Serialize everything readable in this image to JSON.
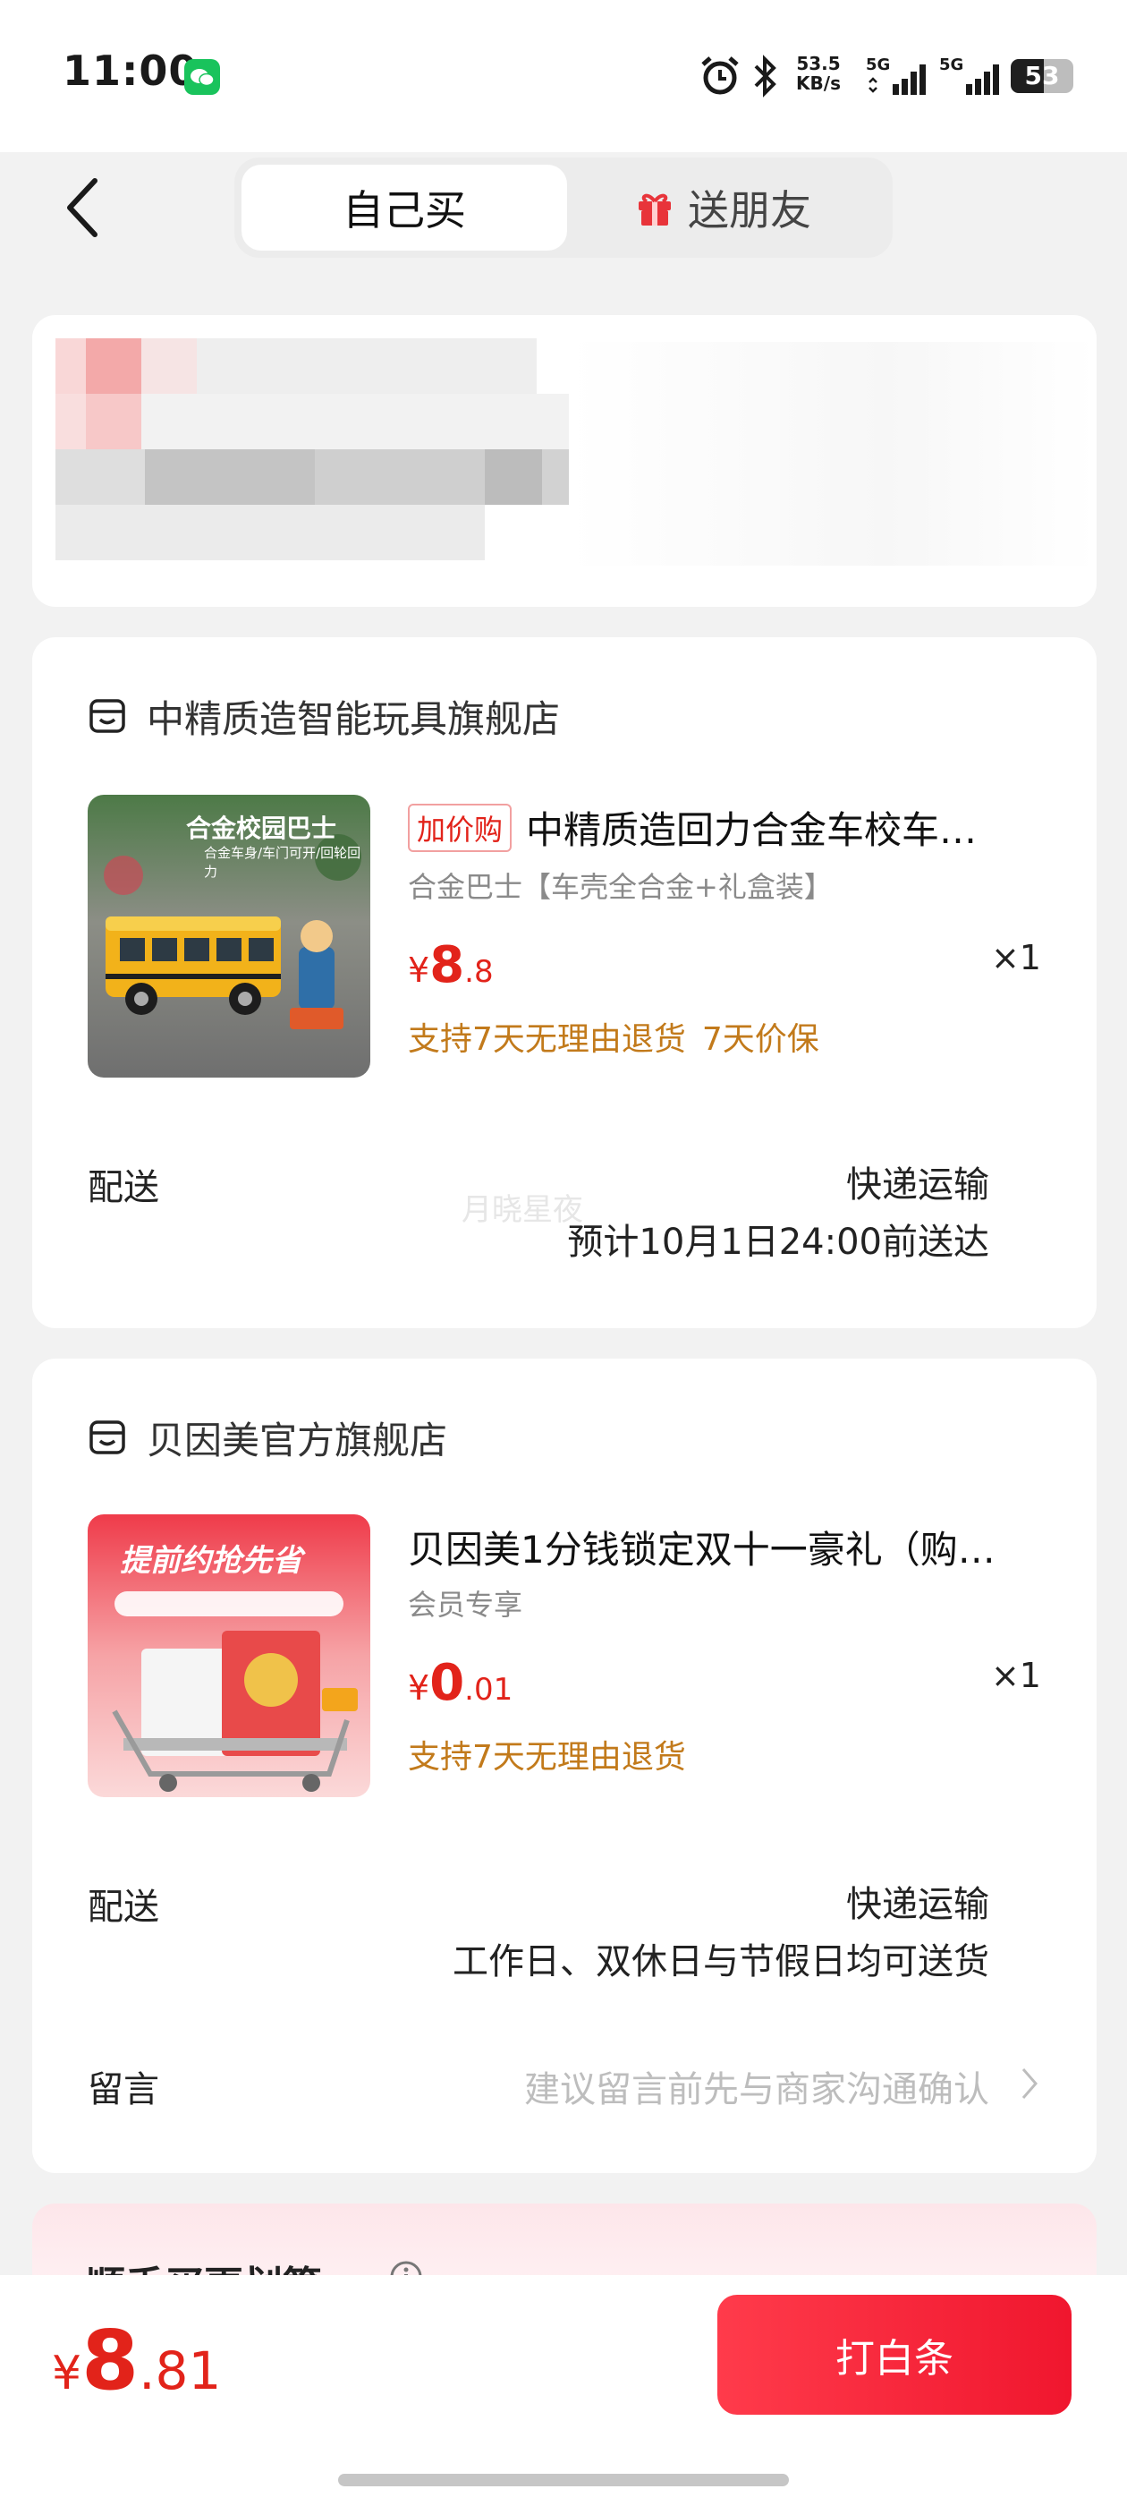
{
  "status_bar": {
    "time": "11:00",
    "net_speed_value": "53.5",
    "net_speed_unit": "KB/s",
    "signal_1": "5G",
    "signal_2": "5G",
    "battery": "53",
    "battery_level": 0.53
  },
  "tabs": {
    "self_buy": "自己买",
    "send_friend": "送朋友"
  },
  "stores": [
    {
      "name": "中精质造智能玩具旗舰店",
      "product": {
        "tag": "加价购",
        "title": "中精质造回力合金车校车…",
        "spec": "合金巴士【车壳全合金+礼盒装】",
        "price_symbol": "¥",
        "price_int": "8",
        "price_dec": ".8",
        "qty": "×1",
        "services": [
          "支持7天无理由退货",
          "7天价保"
        ],
        "image_caption": "合金校园巴士",
        "image_subcaption": "合金车身/车门可开/回轮回力"
      },
      "delivery_label": "配送",
      "delivery_method": "快递运输",
      "delivery_time": "预计10月1日24:00前送达",
      "watermark": "月晓星夜"
    },
    {
      "name": "贝因美官方旗舰店",
      "product": {
        "title": "贝因美1分钱锁定双十一豪礼（购…",
        "spec": "会员专享",
        "price_symbol": "¥",
        "price_int": "0",
        "price_dec": ".01",
        "qty": "×1",
        "services": [
          "支持7天无理由退货"
        ],
        "image_caption": "提前约抢先省"
      },
      "delivery_label": "配送",
      "delivery_method": "快递运输",
      "delivery_time": "工作日、双休日与节假日均可送货",
      "message_label": "留言",
      "message_placeholder": "建议留言前先与商家沟通确认"
    }
  ],
  "upsell": {
    "title": "顺手买更划算"
  },
  "bottom": {
    "total_symbol": "¥",
    "total_int": "8",
    "total_dec": ".81",
    "pay_label": "打白条"
  },
  "colors": {
    "accent_red": "#e2231a",
    "service_orange": "#c27a1b",
    "wechat_green": "#19c35c"
  },
  "icons": [
    "wechat-icon",
    "alarm-icon",
    "bluetooth-icon",
    "signal-icon",
    "battery-icon",
    "back-icon",
    "gift-icon",
    "store-icon",
    "chevron-right-icon",
    "info-icon"
  ]
}
